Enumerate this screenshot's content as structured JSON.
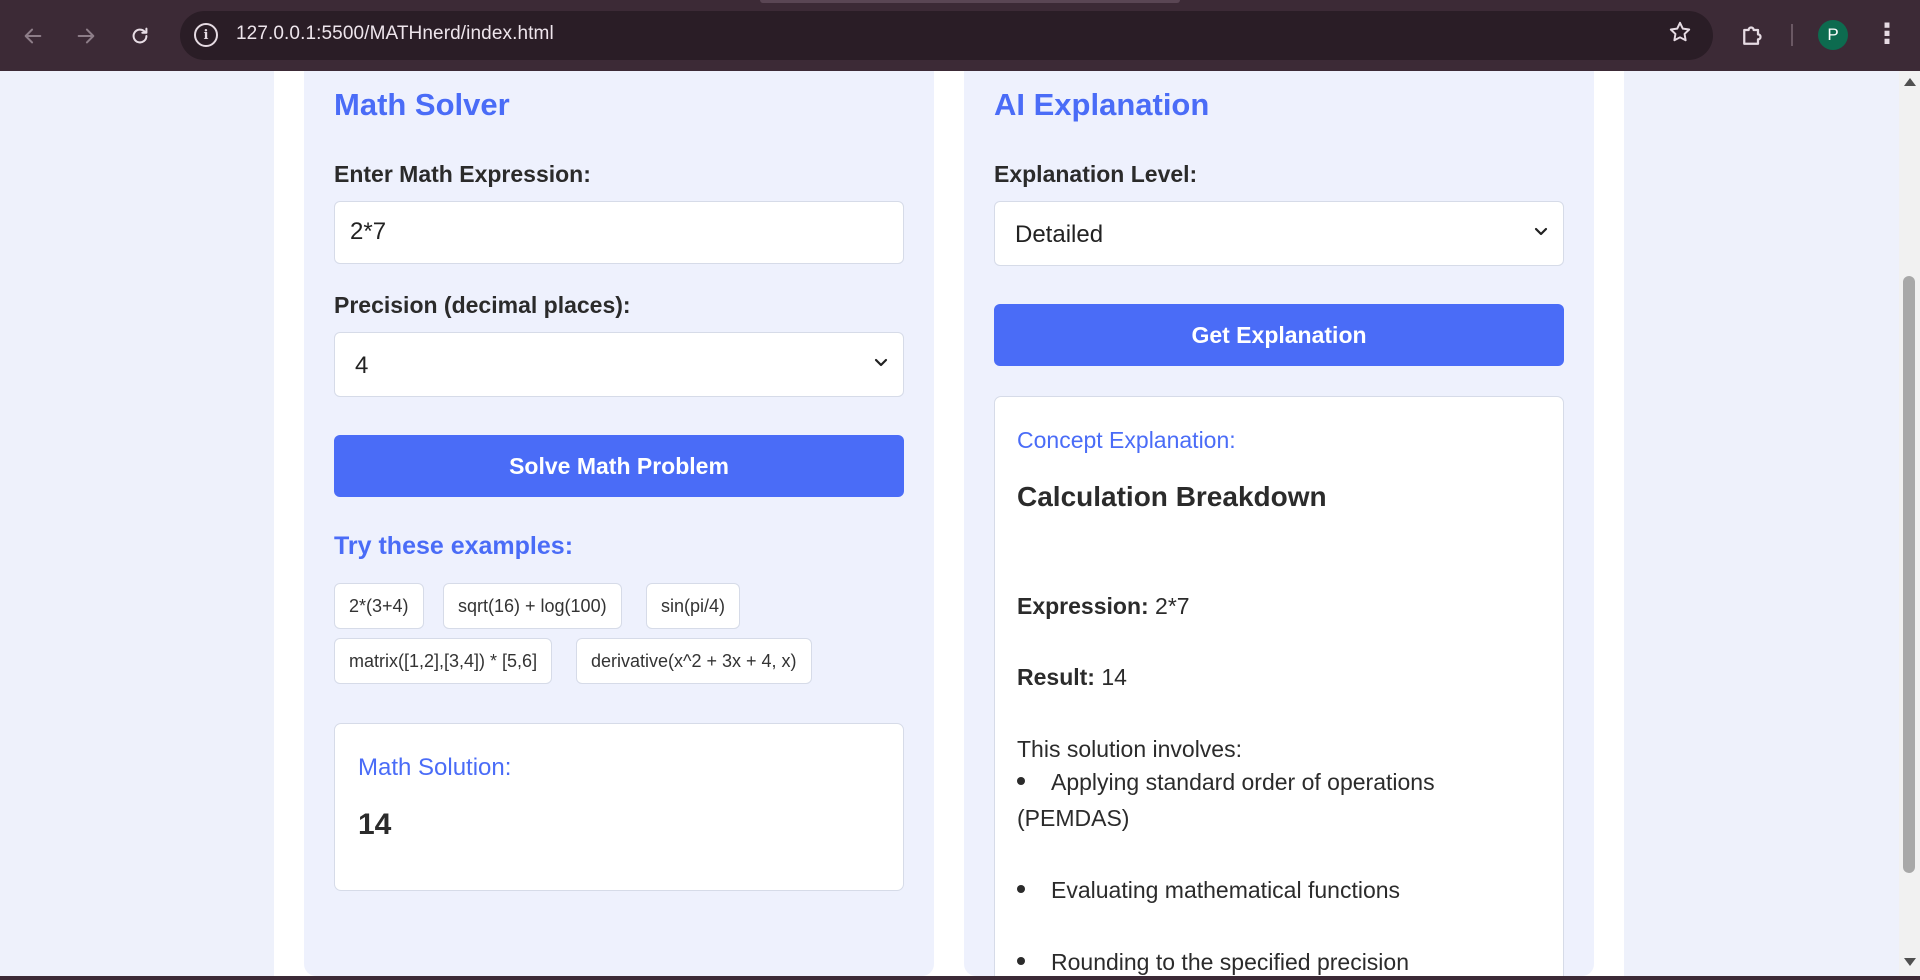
{
  "browser": {
    "url": "127.0.0.1:5500/MATHnerd/index.html",
    "profile_initial": "P",
    "accent": "#4a6cf7"
  },
  "solver": {
    "title": "Math Solver",
    "expression_label": "Enter Math Expression:",
    "expression_value": "2*7",
    "precision_label": "Precision (decimal places):",
    "precision_value": "4",
    "solve_button": "Solve Math Problem",
    "examples_title": "Try these examples:",
    "examples": [
      "2*(3+4)",
      "sqrt(16) + log(100)",
      "sin(pi/4)",
      "matrix([1,2],[3,4]) * [5,6]",
      "derivative(x^2 + 3x + 4, x)"
    ],
    "result_label": "Math Solution:",
    "result_value": "14"
  },
  "explanation": {
    "title": "AI Explanation",
    "level_label": "Explanation Level:",
    "level_value": "Detailed",
    "button": "Get Explanation",
    "card_label": "Concept Explanation:",
    "heading": "Calculation Breakdown",
    "expression_key": "Expression:",
    "expression_val": "2*7",
    "result_key": "Result:",
    "result_val": "14",
    "intro": "This solution involves:",
    "bullets": [
      "Applying standard order of operations (PEMDAS)",
      "Evaluating mathematical functions",
      "Rounding to the specified precision"
    ]
  }
}
